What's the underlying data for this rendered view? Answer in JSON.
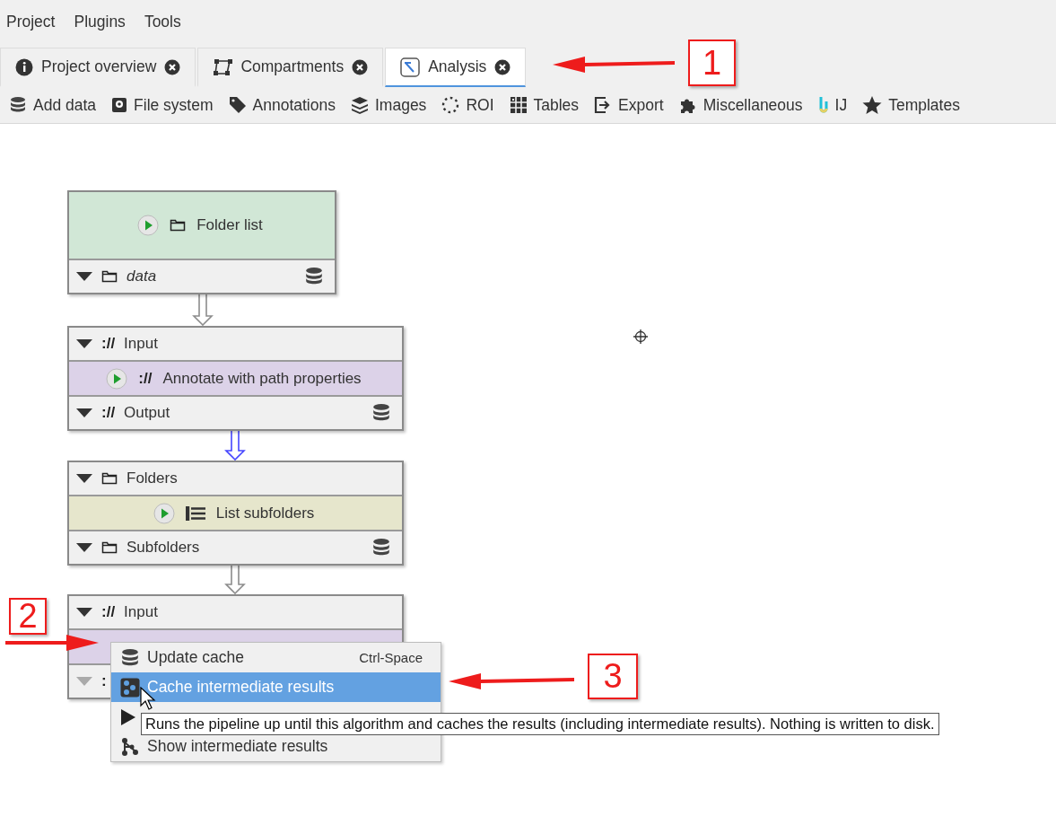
{
  "menu": [
    "Project",
    "Plugins",
    "Tools"
  ],
  "tabs": [
    {
      "label": "Project overview",
      "kind": "info",
      "selected": false
    },
    {
      "label": "Compartments",
      "kind": "compartments",
      "selected": false
    },
    {
      "label": "Analysis",
      "kind": "graph",
      "selected": true
    }
  ],
  "toolbar": [
    {
      "label": "Add data",
      "kind": "database"
    },
    {
      "label": "File system",
      "kind": "disk"
    },
    {
      "label": "Annotations",
      "kind": "tag"
    },
    {
      "label": "Images",
      "kind": "layers"
    },
    {
      "label": "ROI",
      "kind": "roi"
    },
    {
      "label": "Tables",
      "kind": "table"
    },
    {
      "label": "Export",
      "kind": "export"
    },
    {
      "label": "Miscellaneous",
      "kind": "puzzle"
    },
    {
      "label": "IJ",
      "kind": "ij"
    },
    {
      "label": "Templates",
      "kind": "star"
    }
  ],
  "nodes": [
    {
      "color": "#d1e7d6",
      "title": {
        "label": "Folder list",
        "kind": "folder"
      },
      "outputs": [
        {
          "label": "data",
          "kind": "folder",
          "italic": true,
          "cached": true,
          "disabled": false
        }
      ]
    },
    {
      "color": "#dcd2e8",
      "title": {
        "label": "Annotate with path properties",
        "kind": "glyph",
        "glyph": "://"
      },
      "inputs": [
        {
          "label": "Input",
          "kind": "glyph",
          "glyph": "://",
          "italic": false,
          "cached": false,
          "disabled": false
        }
      ],
      "outputs": [
        {
          "label": "Output",
          "kind": "glyph",
          "glyph": "://",
          "italic": false,
          "cached": true,
          "disabled": false
        }
      ]
    },
    {
      "color": "#e6e6cc",
      "title": {
        "label": "List subfolders",
        "kind": "list"
      },
      "inputs": [
        {
          "label": "Folders",
          "kind": "folder",
          "italic": false,
          "cached": false,
          "disabled": false
        }
      ],
      "outputs": [
        {
          "label": "Subfolders",
          "kind": "folder",
          "italic": false,
          "cached": true,
          "disabled": false
        }
      ]
    },
    {
      "color": "#dcd2e8",
      "title": {
        "kind": "hidden"
      },
      "inputs": [
        {
          "label": "Input",
          "kind": "glyph",
          "glyph": "://",
          "italic": false,
          "cached": false,
          "disabled": false
        }
      ],
      "outputs": [
        {
          "kind": "glyph",
          "glyph": ":",
          "disabled": true
        }
      ]
    }
  ],
  "edges": [
    {
      "color": "#8c8c8c"
    },
    {
      "color": "#4646ff"
    },
    {
      "color": "#8c8c8c"
    }
  ],
  "context_menu": [
    {
      "label": "Update cache",
      "shortcut": "Ctrl-Space",
      "kind": "database",
      "selected": false
    },
    {
      "label": "Cache intermediate results",
      "kind": "network",
      "selected": true
    },
    {
      "kind": "run",
      "selected": false
    },
    {
      "label": "Show intermediate results",
      "kind": "tree",
      "selected": false
    }
  ],
  "tooltip": "Runs the pipeline up until this algorithm and caches the results (including intermediate results). Nothing is written to disk.",
  "callouts": [
    "1",
    "2",
    "3"
  ]
}
